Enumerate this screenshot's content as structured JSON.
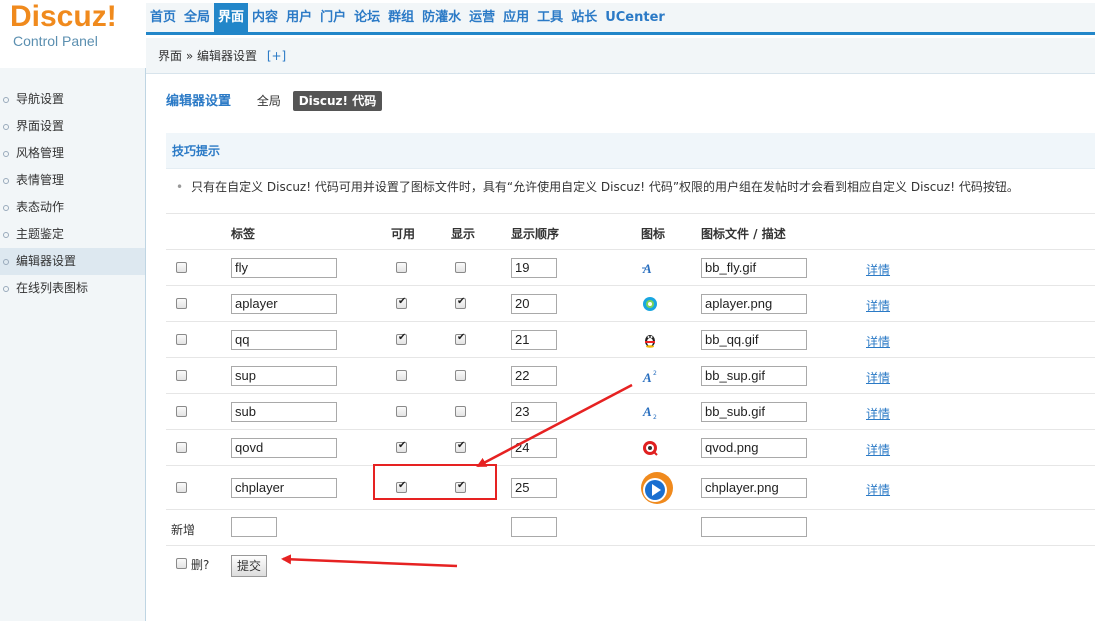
{
  "logo": {
    "brand": "Discuz!",
    "sub": "Control Panel"
  },
  "topnav": [
    "首页",
    "全局",
    "界面",
    "内容",
    "用户",
    "门户",
    "论坛",
    "群组",
    "防灌水",
    "运营",
    "应用",
    "工具",
    "站长",
    "UCenter"
  ],
  "topnav_active": "界面",
  "breadcrumb": {
    "text": "界面 » 编辑器设置",
    "plus": "[+]"
  },
  "sidebar": {
    "items": [
      "导航设置",
      "界面设置",
      "风格管理",
      "表情管理",
      "表态动作",
      "主题鉴定",
      "编辑器设置",
      "在线列表图标"
    ],
    "active_index": 6
  },
  "tabs": {
    "title": "编辑器设置",
    "global": "全局",
    "active": "Discuz! 代码"
  },
  "tip": {
    "title": "技巧提示",
    "text": "只有在自定义 Discuz! 代码可用并设置了图标文件时，具有“允许使用自定义 Discuz! 代码”权限的用户组在发帖时才会看到相应自定义 Discuz! 代码按钮。"
  },
  "table": {
    "headers": {
      "tag": "标签",
      "enabled": "可用",
      "show": "显示",
      "order": "显示顺序",
      "icon": "图标",
      "file": "图标文件 / 描述"
    },
    "rows": [
      {
        "tag": "fly",
        "enabled": false,
        "show": false,
        "order": "19",
        "icon": "fly-icon",
        "file": "bb_fly.gif",
        "detail": "详情"
      },
      {
        "tag": "aplayer",
        "enabled": true,
        "show": true,
        "order": "20",
        "icon": "aplayer-icon",
        "file": "aplayer.png",
        "detail": "详情"
      },
      {
        "tag": "qq",
        "enabled": true,
        "show": true,
        "order": "21",
        "icon": "qq-penguin-icon",
        "file": "bb_qq.gif",
        "detail": "详情"
      },
      {
        "tag": "sup",
        "enabled": false,
        "show": false,
        "order": "22",
        "icon": "superscript-icon",
        "file": "bb_sup.gif",
        "detail": "详情"
      },
      {
        "tag": "sub",
        "enabled": false,
        "show": false,
        "order": "23",
        "icon": "subscript-icon",
        "file": "bb_sub.gif",
        "detail": "详情"
      },
      {
        "tag": "qovd",
        "enabled": true,
        "show": true,
        "order": "24",
        "icon": "qvod-icon",
        "file": "qvod.png",
        "detail": "详情"
      },
      {
        "tag": "chplayer",
        "enabled": true,
        "show": true,
        "order": "25",
        "icon": "chplayer-icon",
        "file": "chplayer.png",
        "detail": "详情"
      }
    ],
    "new_label": "新增",
    "delete_label": "删?",
    "submit_label": "提交"
  },
  "colors": {
    "accent": "#2286c9",
    "link": "#2b7ac6",
    "logo": "#f08a1d",
    "annotation": "#e62222"
  }
}
